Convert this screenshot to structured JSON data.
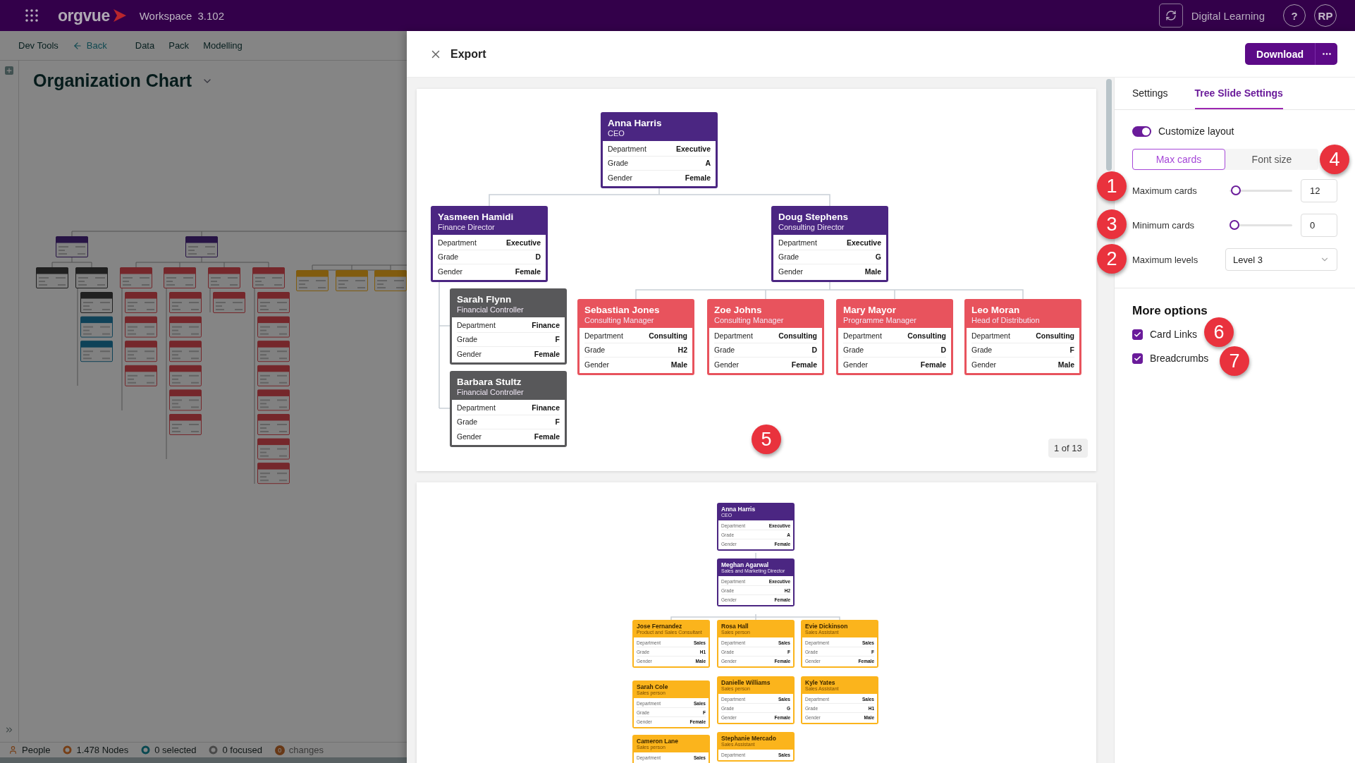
{
  "top_bar": {
    "logo": "orgvue",
    "workspace": "Workspace",
    "version": "3.102",
    "user_label": "Digital Learning",
    "help": "?",
    "avatar": "RP"
  },
  "background_app": {
    "nav": [
      {
        "label": "Dev Tools",
        "kind": "link"
      },
      {
        "label": "Back",
        "kind": "back"
      },
      {
        "label": "Data",
        "kind": "link"
      },
      {
        "label": "Pack",
        "kind": "link"
      },
      {
        "label": "Modelling",
        "kind": "link"
      }
    ],
    "view_title": "Organization Chart",
    "status_bar": [
      {
        "label": "People",
        "kind": "people"
      },
      {
        "label": "1.478 Nodes",
        "kind": "nodes"
      },
      {
        "label": "0 selected",
        "kind": "selected"
      },
      {
        "label": "0 focused",
        "kind": "focused"
      },
      {
        "label": "changes",
        "kind": "changes",
        "count": "0"
      }
    ]
  },
  "export": {
    "title": "Export",
    "download": "Download",
    "slides": [
      {
        "page_label": "1 of 13",
        "cards": [
          {
            "name": "Anna Harris",
            "title": "CEO",
            "color": "#4b2682",
            "fields": [
              {
                "label": "Department",
                "value": "Executive"
              },
              {
                "label": "Grade",
                "value": "A"
              },
              {
                "label": "Gender",
                "value": "Female"
              }
            ]
          },
          {
            "name": "Yasmeen Hamidi",
            "title": "Finance Director",
            "color": "#4b2682",
            "fields": [
              {
                "label": "Department",
                "value": "Executive"
              },
              {
                "label": "Grade",
                "value": "D"
              },
              {
                "label": "Gender",
                "value": "Female"
              }
            ]
          },
          {
            "name": "Doug Stephens",
            "title": "Consulting Director",
            "color": "#4b2682",
            "fields": [
              {
                "label": "Department",
                "value": "Executive"
              },
              {
                "label": "Grade",
                "value": "G"
              },
              {
                "label": "Gender",
                "value": "Male"
              }
            ]
          },
          {
            "name": "Sarah Flynn",
            "title": "Financial Controller",
            "color": "#58585a",
            "fields": [
              {
                "label": "Department",
                "value": "Finance"
              },
              {
                "label": "Grade",
                "value": "F"
              },
              {
                "label": "Gender",
                "value": "Female"
              }
            ]
          },
          {
            "name": "Barbara Stultz",
            "title": "Financial Controller",
            "color": "#58585a",
            "fields": [
              {
                "label": "Department",
                "value": "Finance"
              },
              {
                "label": "Grade",
                "value": "F"
              },
              {
                "label": "Gender",
                "value": "Female"
              }
            ]
          },
          {
            "name": "Sebastian Jones",
            "title": "Consulting Manager",
            "color": "#e8535d",
            "fields": [
              {
                "label": "Department",
                "value": "Consulting"
              },
              {
                "label": "Grade",
                "value": "H2"
              },
              {
                "label": "Gender",
                "value": "Male"
              }
            ]
          },
          {
            "name": "Zoe Johns",
            "title": "Consulting Manager",
            "color": "#e8535d",
            "fields": [
              {
                "label": "Department",
                "value": "Consulting"
              },
              {
                "label": "Grade",
                "value": "D"
              },
              {
                "label": "Gender",
                "value": "Female"
              }
            ]
          },
          {
            "name": "Mary Mayor",
            "title": "Programme Manager",
            "color": "#e8535d",
            "fields": [
              {
                "label": "Department",
                "value": "Consulting"
              },
              {
                "label": "Grade",
                "value": "D"
              },
              {
                "label": "Gender",
                "value": "Female"
              }
            ]
          },
          {
            "name": "Leo Moran",
            "title": "Head of Distribution",
            "color": "#e8535d",
            "fields": [
              {
                "label": "Department",
                "value": "Consulting"
              },
              {
                "label": "Grade",
                "value": "F"
              },
              {
                "label": "Gender",
                "value": "Male"
              }
            ]
          }
        ]
      },
      {
        "cards": [
          {
            "name": "Anna Harris",
            "title": "CEO",
            "color": "#4b2682",
            "fields": [
              {
                "label": "Department",
                "value": "Executive"
              },
              {
                "label": "Grade",
                "value": "A"
              },
              {
                "label": "Gender",
                "value": "Female"
              }
            ]
          },
          {
            "name": "Meghan Agarwal",
            "title": "Sales and Marketing Director",
            "color": "#4b2682",
            "fields": [
              {
                "label": "Department",
                "value": "Executive"
              },
              {
                "label": "Grade",
                "value": "H2"
              },
              {
                "label": "Gender",
                "value": "Female"
              }
            ]
          },
          {
            "name": "Jose Fernandez",
            "title": "Product and Sales Consultant",
            "color": "#fbb41c",
            "fields": [
              {
                "label": "Department",
                "value": "Sales"
              },
              {
                "label": "Grade",
                "value": "H1"
              },
              {
                "label": "Gender",
                "value": "Male"
              }
            ]
          },
          {
            "name": "Rosa Hall",
            "title": "Sales person",
            "color": "#fbb41c",
            "fields": [
              {
                "label": "Department",
                "value": "Sales"
              },
              {
                "label": "Grade",
                "value": "F"
              },
              {
                "label": "Gender",
                "value": "Female"
              }
            ]
          },
          {
            "name": "Evie Dickinson",
            "title": "Sales Assistant",
            "color": "#fbb41c",
            "fields": [
              {
                "label": "Department",
                "value": "Sales"
              },
              {
                "label": "Grade",
                "value": "F"
              },
              {
                "label": "Gender",
                "value": "Female"
              }
            ]
          },
          {
            "name": "Sarah Cole",
            "title": "Sales person",
            "color": "#fbb41c",
            "fields": [
              {
                "label": "Department",
                "value": "Sales"
              },
              {
                "label": "Grade",
                "value": "F"
              },
              {
                "label": "Gender",
                "value": "Female"
              }
            ]
          },
          {
            "name": "Danielle Williams",
            "title": "Sales person",
            "color": "#fbb41c",
            "fields": [
              {
                "label": "Department",
                "value": "Sales"
              },
              {
                "label": "Grade",
                "value": "G"
              },
              {
                "label": "Gender",
                "value": "Female"
              }
            ]
          },
          {
            "name": "Kyle Yates",
            "title": "Sales Assistant",
            "color": "#fbb41c",
            "fields": [
              {
                "label": "Department",
                "value": "Sales"
              },
              {
                "label": "Grade",
                "value": "H1"
              },
              {
                "label": "Gender",
                "value": "Male"
              }
            ]
          },
          {
            "name": "Cameron Lane",
            "title": "Sales person",
            "color": "#fbb41c",
            "fields": [
              {
                "label": "Department",
                "value": "Sales"
              }
            ]
          },
          {
            "name": "Stephanie Mercado",
            "title": "Sales Assistant",
            "color": "#fbb41c",
            "fields": [
              {
                "label": "Department",
                "value": "Sales"
              }
            ]
          }
        ]
      }
    ]
  },
  "settings_panel": {
    "tabs": [
      {
        "label": "Settings",
        "selected": false
      },
      {
        "label": "Tree Slide Settings",
        "selected": true
      }
    ],
    "customize_layout": {
      "label": "Customize layout",
      "on": true
    },
    "modes": [
      {
        "label": "Max cards",
        "selected": true
      },
      {
        "label": "Font size",
        "selected": false
      }
    ],
    "controls": [
      {
        "kind": "slider",
        "label": "Maximum cards",
        "level": 0.03,
        "value": "12"
      },
      {
        "kind": "slider",
        "label": "Minimum cards",
        "level": 0,
        "value": "0"
      },
      {
        "kind": "select",
        "label": "Maximum levels",
        "value": "Level 3"
      }
    ],
    "more_options": {
      "heading": "More options",
      "items": [
        {
          "label": "Card Links",
          "checked": true
        },
        {
          "label": "Breadcrumbs",
          "checked": true
        }
      ]
    }
  },
  "annotations": [
    {
      "label": "4"
    },
    {
      "label": "1"
    },
    {
      "label": "3"
    },
    {
      "label": "2"
    },
    {
      "label": "6"
    },
    {
      "label": "7"
    },
    {
      "label": "5"
    }
  ]
}
